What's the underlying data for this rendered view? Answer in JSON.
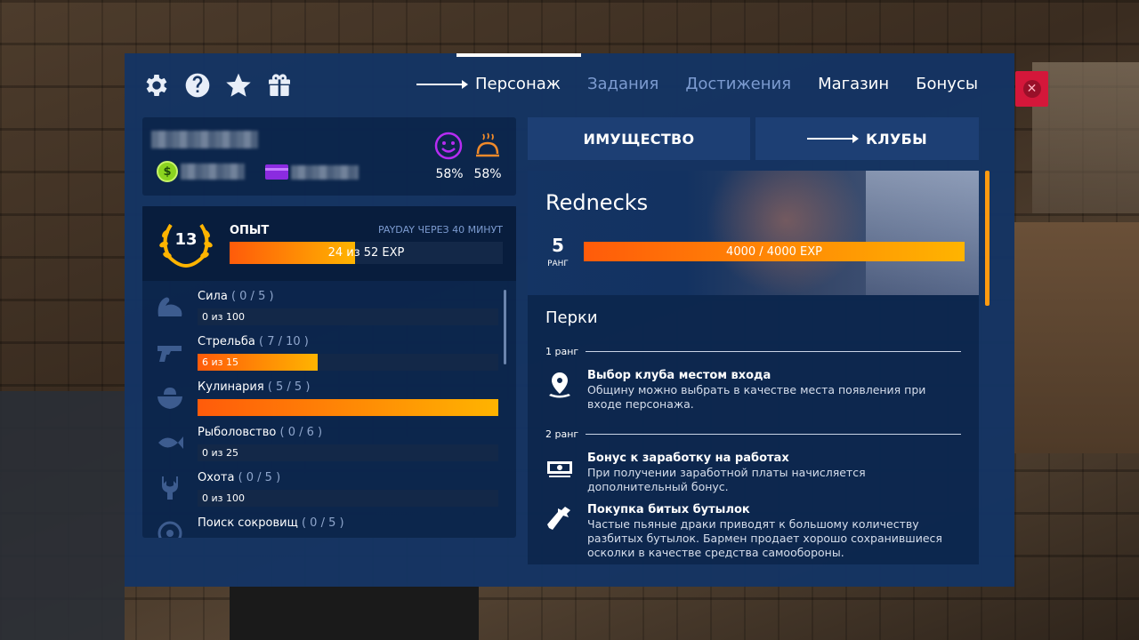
{
  "header": {
    "icons": [
      "gear-icon",
      "help-icon",
      "star-icon",
      "gift-icon"
    ],
    "tabs": [
      {
        "label": "Персонаж",
        "active": true
      },
      {
        "label": "Задания",
        "active": false
      },
      {
        "label": "Достижения",
        "active": false
      },
      {
        "label": "Магазин",
        "active": false
      },
      {
        "label": "Бонусы",
        "active": false
      }
    ]
  },
  "profile": {
    "mood": "58%",
    "hunger": "58%"
  },
  "experience": {
    "level": "13",
    "label": "ОПЫТ",
    "payday": "PAYDAY ЧЕРЕЗ 40 МИНУТ",
    "progress_text": "24 из 52 EXP",
    "progress_fraction": 0.46
  },
  "skills": [
    {
      "name": "Сила",
      "count": "( 0 / 5 )",
      "progress_text": "0 из 100",
      "fraction": 0.0,
      "icon": "muscle-icon"
    },
    {
      "name": "Стрельба",
      "count": "( 7 / 10 )",
      "progress_text": "6 из 15",
      "fraction": 0.4,
      "icon": "pistol-icon"
    },
    {
      "name": "Кулинария",
      "count": "( 5 / 5 )",
      "progress_text": "",
      "fraction": 1.0,
      "icon": "food-bowl-icon"
    },
    {
      "name": "Рыболовство",
      "count": "( 0 / 6 )",
      "progress_text": "0 из 25",
      "fraction": 0.0,
      "icon": "fish-icon"
    },
    {
      "name": "Охота",
      "count": "( 0 / 5 )",
      "progress_text": "0 из 100",
      "fraction": 0.0,
      "icon": "antlers-icon"
    },
    {
      "name": "Поиск сокровищ",
      "count": "( 0 / 5 )",
      "progress_text": "",
      "fraction": 0.0,
      "icon": "treasure-icon"
    }
  ],
  "sub_tabs": [
    {
      "label": "ИМУЩЕСТВО",
      "active": false
    },
    {
      "label": "КЛУБЫ",
      "active": true
    }
  ],
  "club": {
    "name": "Rednecks",
    "rank": "5",
    "rank_label": "РАНГ",
    "progress_text": "4000 / 4000 EXP",
    "progress_fraction": 1.0,
    "perks_title": "Перки",
    "ranks": [
      {
        "label": "1 ранг",
        "perks": [
          {
            "title": "Выбор клуба местом входа",
            "desc": "Общину можно выбрать в качестве места появления при входе персонажа.",
            "icon": "location-pin-icon"
          }
        ]
      },
      {
        "label": "2 ранг",
        "perks": [
          {
            "title": "Бонус к заработку на работах",
            "desc": "При получении заработной платы начисляется дополнительный бонус.",
            "icon": "cash-icon"
          },
          {
            "title": "Покупка битых бутылок",
            "desc": "Частые пьяные драки приводят к большому количеству разбитых бутылок. Бармен продает хорошо сохранившиеся осколки в качестве средства самообороны.",
            "icon": "broken-bottle-icon"
          }
        ]
      }
    ]
  },
  "colors": {
    "panel": "#143464",
    "accent_orange": "#ff5b0a",
    "accent_yellow": "#ffb400",
    "close_red": "#d4173a",
    "mood_purple": "#b52cf2",
    "hunger_orange": "#f08a2a"
  }
}
